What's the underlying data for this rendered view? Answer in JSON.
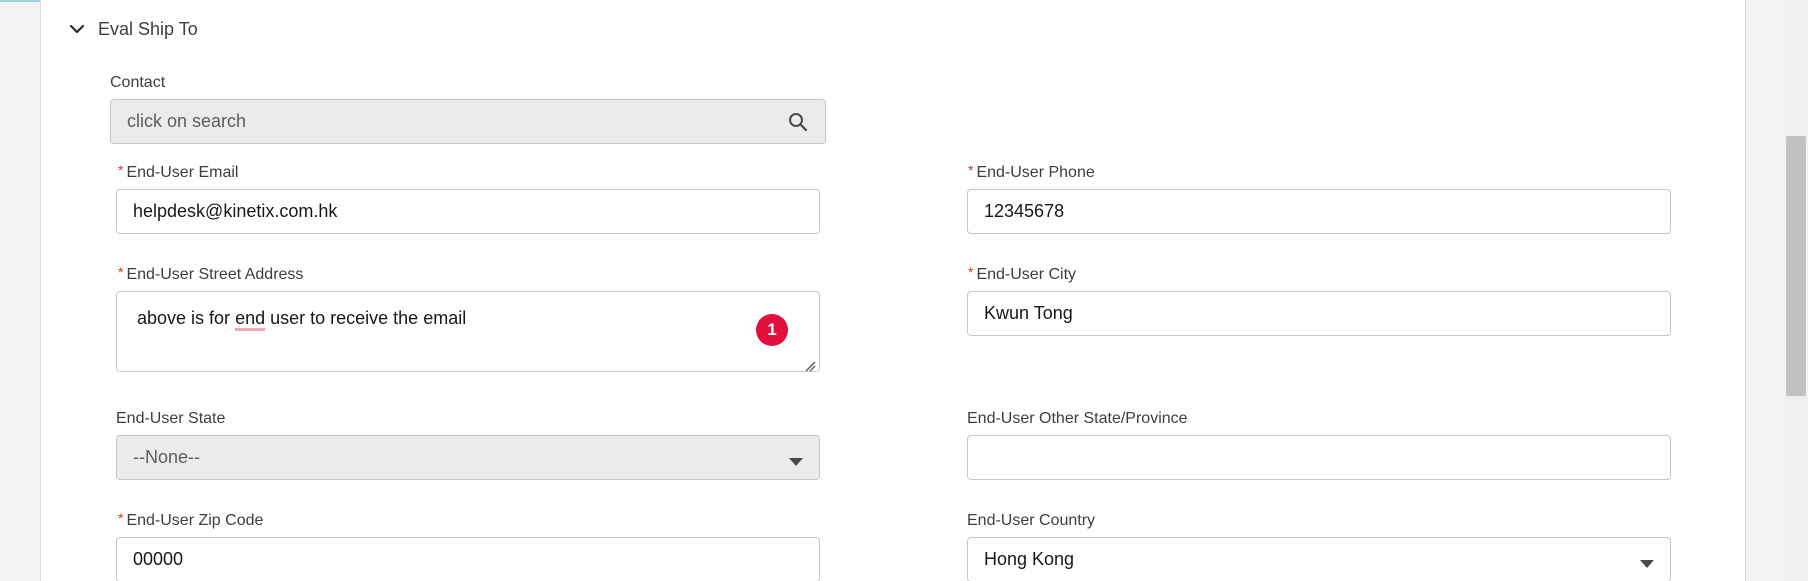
{
  "section": {
    "title": "Eval Ship To",
    "collapse_icon": "chevron-down-icon"
  },
  "contact": {
    "label": "Contact",
    "placeholder": "click on search",
    "icon": "search-icon"
  },
  "fields": {
    "email": {
      "label": "End-User Email",
      "required_mark": "*",
      "value": "helpdesk@kinetix.com.hk"
    },
    "phone": {
      "label": "End-User Phone",
      "required_mark": "*",
      "value": "12345678"
    },
    "street": {
      "label": "End-User Street Address",
      "required_mark": "*",
      "value_before": "above is for ",
      "value_misspelled": "end",
      "value_after": " user to receive the email"
    },
    "city": {
      "label": "End-User City",
      "required_mark": "*",
      "value": "Kwun Tong"
    },
    "state": {
      "label": "End-User State",
      "value": "--None--"
    },
    "other_state": {
      "label": "End-User Other State/Province",
      "value": ""
    },
    "zip": {
      "label": "End-User Zip Code",
      "required_mark": "*",
      "value": "00000"
    },
    "country": {
      "label": "End-User Country",
      "value": "Hong Kong"
    }
  },
  "annotation_badge": "1",
  "colors": {
    "required": "#c23934",
    "badge": "#e3103d",
    "spell_underline": "#f3a7b4"
  }
}
